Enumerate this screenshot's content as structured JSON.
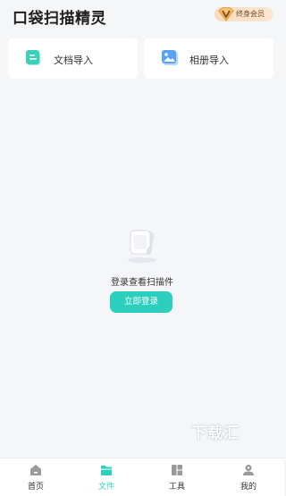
{
  "header": {
    "title": "口袋扫描精灵",
    "vip_label": "终身会员"
  },
  "import_cards": [
    {
      "label": "文档导入",
      "icon": "document-icon"
    },
    {
      "label": "相册导入",
      "icon": "photo-album-icon"
    }
  ],
  "empty_state": {
    "message": "登录查看扫描件",
    "button_label": "立即登录",
    "illustration": "document-illustration-icon"
  },
  "watermark": "下载汇",
  "tabbar": {
    "active": "文件",
    "items": [
      {
        "label": "首页",
        "icon": "home-icon"
      },
      {
        "label": "文件",
        "icon": "folder-icon"
      },
      {
        "label": "工具",
        "icon": "tools-icon"
      },
      {
        "label": "我的",
        "icon": "profile-icon"
      }
    ]
  },
  "colors": {
    "accent": "#2ccfbd",
    "background": "#f5f6f8",
    "vip_gold": "#f9dcbf"
  }
}
